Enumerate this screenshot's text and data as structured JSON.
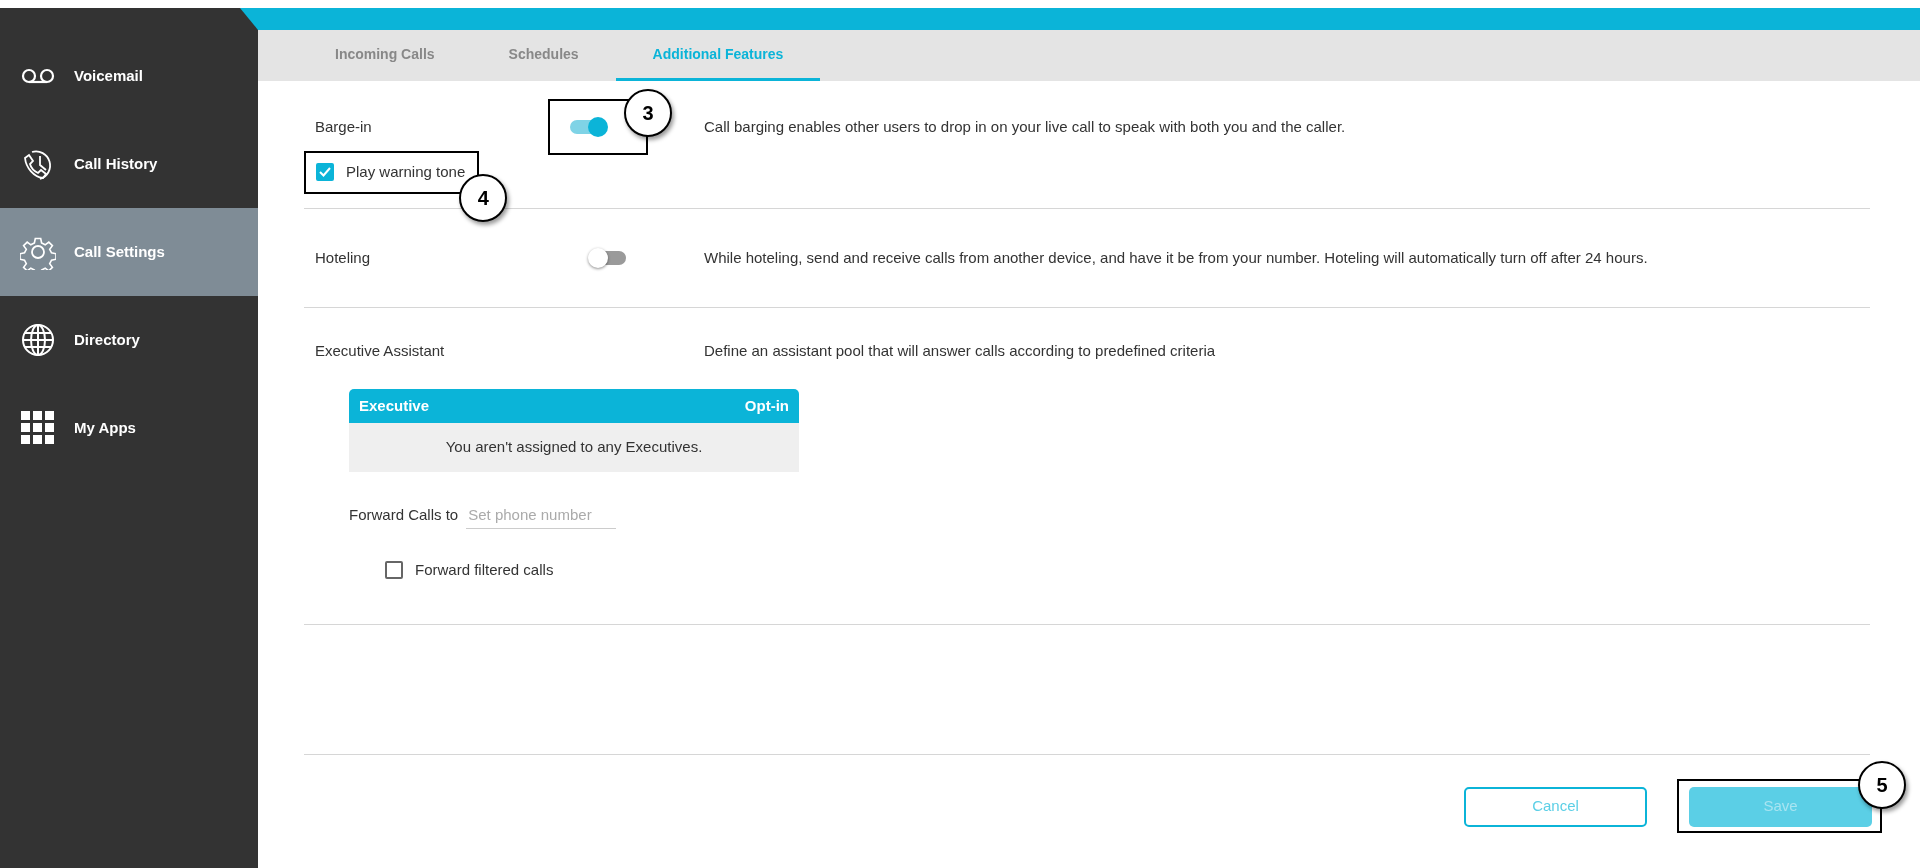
{
  "sidebar": {
    "items": [
      {
        "label": "Voicemail",
        "selected": false
      },
      {
        "label": "Call History",
        "selected": false
      },
      {
        "label": "Call Settings",
        "selected": true
      },
      {
        "label": "Directory",
        "selected": false
      },
      {
        "label": "My Apps",
        "selected": false
      }
    ]
  },
  "tabs": [
    {
      "label": "Incoming Calls",
      "selected": false
    },
    {
      "label": "Schedules",
      "selected": false
    },
    {
      "label": "Additional Features",
      "selected": true
    }
  ],
  "features": [
    {
      "kind": "toggle",
      "label": "Barge-in",
      "on": true,
      "callout": "3",
      "description": "Call barging enables other users to drop in on your live call to speak with both you and the caller.",
      "options": [
        {
          "label": "Play warning tone",
          "checked": true,
          "callout": "4"
        }
      ]
    },
    {
      "kind": "toggle",
      "label": "Hoteling",
      "on": false,
      "description": "While hoteling, send and receive calls from another device, and have it be from your number. Hoteling will automatically turn off after 24 hours."
    },
    {
      "kind": "executive",
      "label": "Executive Assistant",
      "description": "Define an assistant pool that will answer calls according to predefined criteria",
      "table": {
        "columns": [
          "Executive",
          "Opt-in"
        ],
        "empty_text": "You aren't assigned to any Executives."
      },
      "forward": {
        "label": "Forward Calls to",
        "placeholder": "Set phone number"
      },
      "options": [
        {
          "label": "Forward filtered calls",
          "checked": false
        }
      ]
    }
  ],
  "buttons": [
    {
      "label": "Cancel",
      "kind": "outline",
      "disabled": false
    },
    {
      "label": "Save",
      "kind": "primary",
      "disabled": true,
      "callout": "5"
    }
  ]
}
